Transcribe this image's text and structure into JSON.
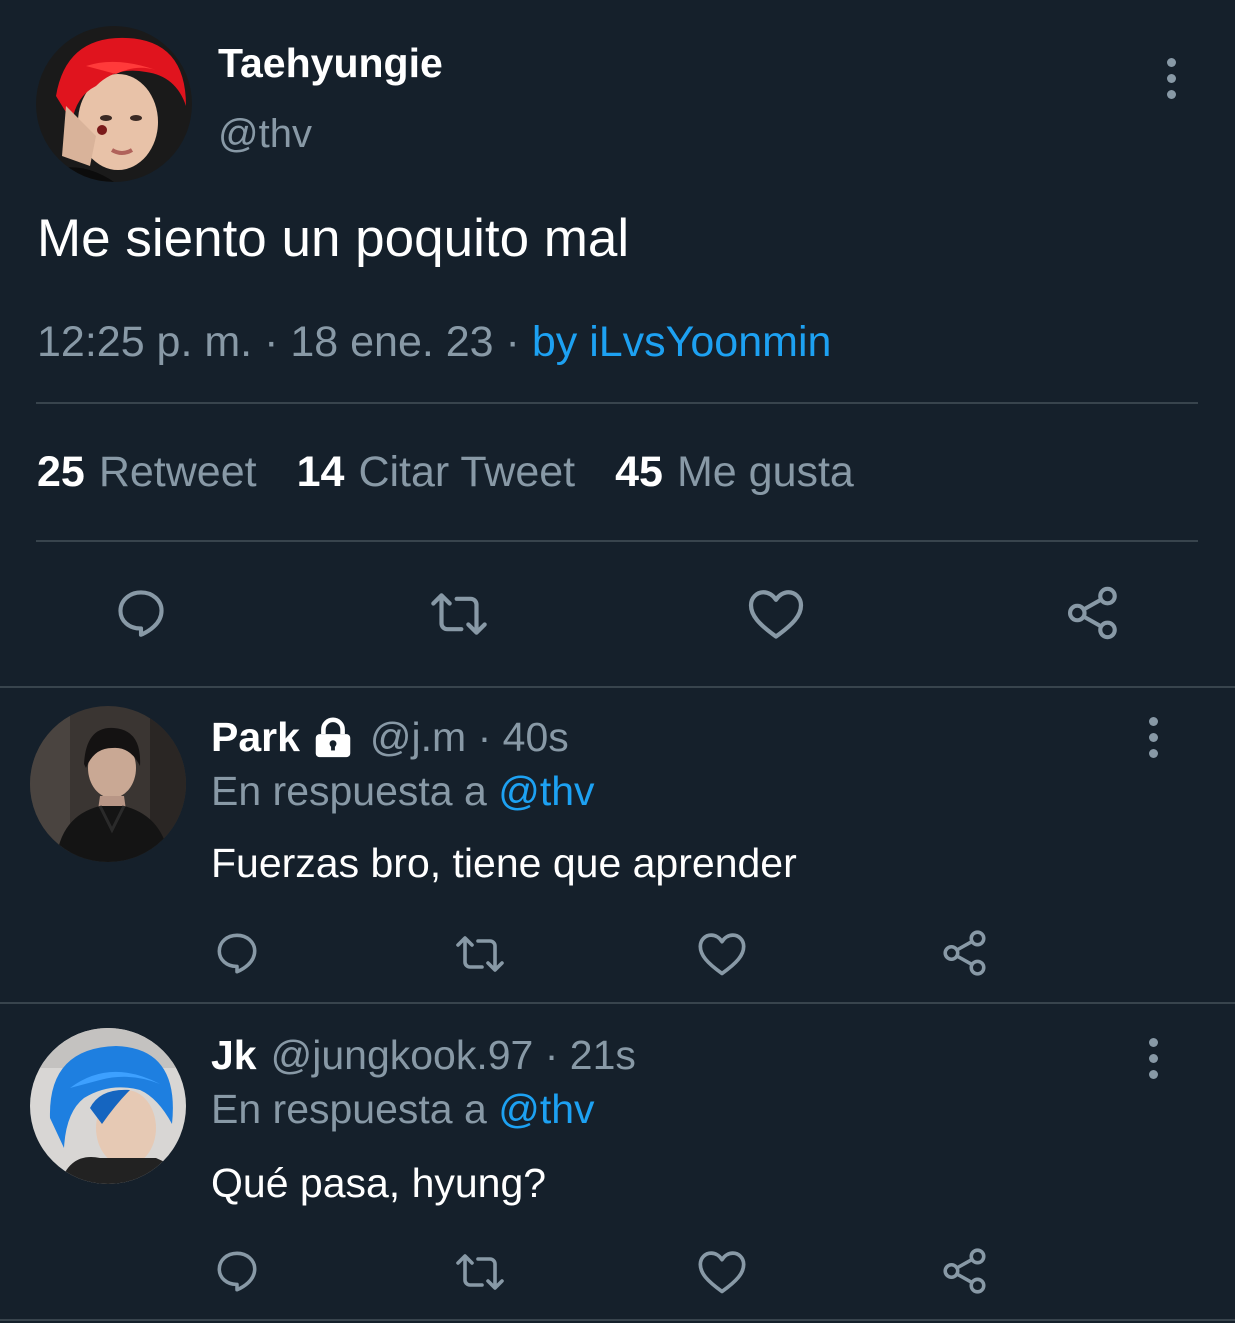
{
  "colors": {
    "background": "#15202b",
    "text_primary": "#ffffff",
    "text_secondary": "#8899a6",
    "link": "#1da1f2",
    "divider": "#38444d"
  },
  "main_tweet": {
    "display_name": "Taehyungie",
    "handle": "@thv",
    "text": "Me siento un poquito mal",
    "time": "12:25 p. m.",
    "sep1": " · ",
    "date": "18 ene. 23",
    "sep2": " · ",
    "source": "by iLvsYoonmin",
    "stats": {
      "retweets_count": "25",
      "retweets_label": "Retweet",
      "quotes_count": "14",
      "quotes_label": "Citar Tweet",
      "likes_count": "45",
      "likes_label": "Me gusta"
    },
    "avatar_icon": "avatar-red-hair",
    "actions": [
      "reply-icon",
      "retweet-icon",
      "like-icon",
      "share-icon"
    ]
  },
  "replies": [
    {
      "display_name": "Park",
      "locked_icon": "lock-icon",
      "handle": "@j.m",
      "sep": " · ",
      "time": "40s",
      "reply_prefix": "En respuesta a",
      "reply_to": "@thv",
      "text": "Fuerzas bro, tiene que aprender",
      "avatar_icon": "avatar-dark-hair"
    },
    {
      "display_name": "Jk",
      "handle": "@jungkook.97",
      "sep": " · ",
      "time": "21s",
      "reply_prefix": "En respuesta a",
      "reply_to": "@thv",
      "text": "Qué pasa, hyung?",
      "avatar_icon": "avatar-blue-hair"
    }
  ]
}
